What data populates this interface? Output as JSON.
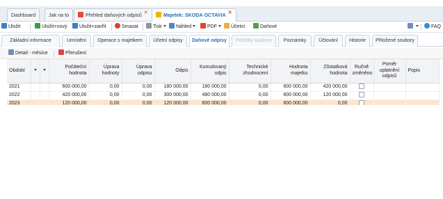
{
  "doc_tabs": [
    {
      "label": "Dashboard"
    },
    {
      "label": "Jak na to"
    },
    {
      "label": "Přehled daňových odpisů"
    },
    {
      "label": "Majetek: SKODA OCTAVIA"
    }
  ],
  "toolbar": {
    "save": "Uložit",
    "save_new": "Uložit+nový",
    "save_close": "Uložit+zavřít",
    "delete": "Smazat",
    "print": "Tisk",
    "preview": "Náhled",
    "pdf": "PDF",
    "accounting": "Účetní",
    "tax": "Daňové",
    "faq": "FAQ"
  },
  "subtabs": [
    {
      "label": "Základní informace"
    },
    {
      "label": "Umístění"
    },
    {
      "label": "Operace s majetkem"
    },
    {
      "label": "Účetní odpisy"
    },
    {
      "label": "Daňové odpisy"
    },
    {
      "label": "Položky souboru"
    },
    {
      "label": "Poznámky"
    },
    {
      "label": "Účtování"
    },
    {
      "label": "Historie"
    },
    {
      "label": "Přiložené soubory"
    }
  ],
  "gridbar": {
    "detail_months": "Detail - měsíce",
    "interruption": "Přerušení"
  },
  "columns": {
    "obdobi": "Období",
    "pocatecni": "Počáteční hodnota",
    "uprava_hodnoty": "Úprava hodnoty",
    "uprava_odpisu": "Úprava odpisu",
    "odpis": "Odpis",
    "kumulovany": "Kumulovaný odpis",
    "technicke": "Technické zhodnocení",
    "hodnota_majetku": "Hodnota majetku",
    "zustatkova": "Zůstatková hodnota",
    "rucne": "Ručně změněno",
    "pomer": "Poměr uplatnění odpisů",
    "popis": "Popis"
  },
  "rows": [
    {
      "obdobi": "2021",
      "pocatecni": "600 000,00",
      "uprava_hodnoty": "0,00",
      "uprava_odpisu": "0,00",
      "odpis": "180 000,00",
      "kumulovany": "180 000,00",
      "technicke": "0,00",
      "hodnota_majetku": "600 000,00",
      "zustatkova": "420 000,00",
      "pomer": "",
      "popis": ""
    },
    {
      "obdobi": "2022",
      "pocatecni": "420 000,00",
      "uprava_hodnoty": "0,00",
      "uprava_odpisu": "0,00",
      "odpis": "300 000,00",
      "kumulovany": "480 000,00",
      "technicke": "0,00",
      "hodnota_majetku": "600 000,00",
      "zustatkova": "120 000,00",
      "pomer": "",
      "popis": ""
    },
    {
      "obdobi": "2023",
      "pocatecni": "120 000,00",
      "uprava_hodnoty": "0,00",
      "uprava_odpisu": "0,00",
      "odpis": "120 000,00",
      "kumulovany": "600 000,00",
      "technicke": "0,00",
      "hodnota_majetku": "600 000,00",
      "zustatkova": "0,00",
      "pomer": "",
      "popis": ""
    }
  ],
  "colors": {
    "accent": "#2a6fc9",
    "selected_row": "#fde4cc",
    "close": "#d44444"
  }
}
